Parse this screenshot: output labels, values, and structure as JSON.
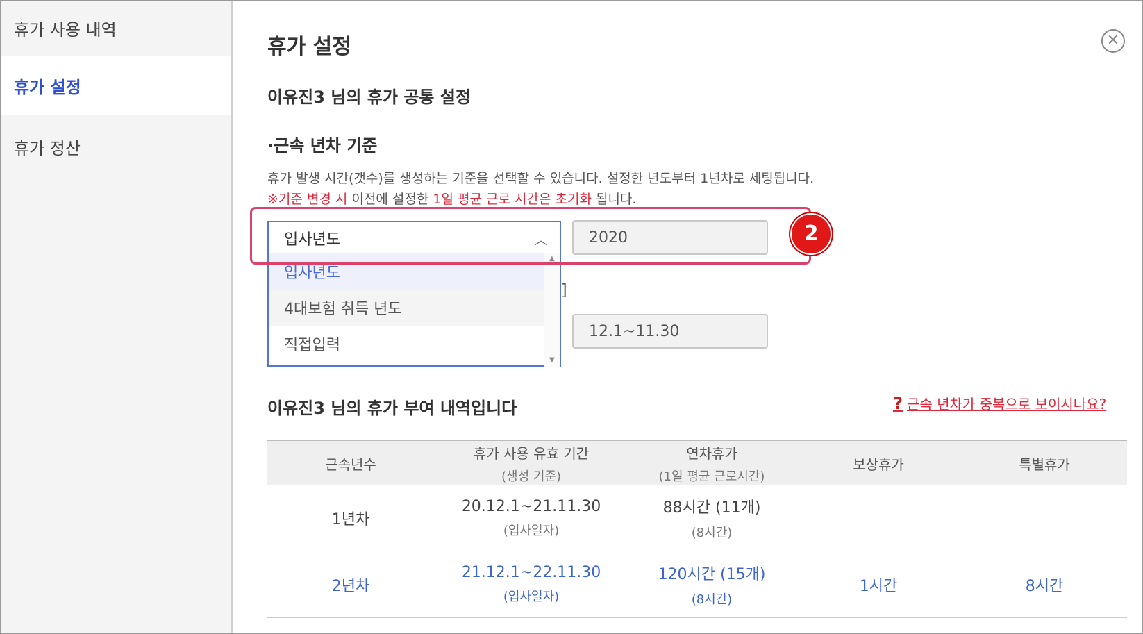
{
  "sidebar": {
    "items": [
      {
        "label": "휴가 사용 내역"
      },
      {
        "label": "휴가 설정"
      },
      {
        "label": "휴가 정산"
      }
    ]
  },
  "header": {
    "title": "휴가 설정",
    "close_icon": "close-circle-icon"
  },
  "settings": {
    "common_title": "이유진3 님의 휴가 공통 설정",
    "tenure_title": "·근속 년차 기준",
    "description": "휴가 발생 시간(갯수)를 생성하는 기준을 선택할 수 있습니다. 설정한 년도부터 1년차로 세팅됩니다.",
    "warning_parts": [
      "※기준 변경 시",
      " 이전에 설정한 ",
      "1일 평균 근로 시간은 초기화",
      " 됩니다."
    ],
    "select_value": "입사년도",
    "options": [
      "입사년도",
      "4대보험 취득 년도",
      "직접입력"
    ],
    "year_value": "2020",
    "partial_bracket": "]",
    "period_value": "12.1~11.30",
    "step_badge": "2"
  },
  "grant": {
    "title": "이유진3 님의 휴가 부여 내역입니다",
    "help_link": "근속 년차가 중복으로 보이시나요?",
    "columns": [
      {
        "main": "근속년수",
        "sub": ""
      },
      {
        "main": "휴가 사용 유효 기간",
        "sub": "(생성 기준)"
      },
      {
        "main": "연차휴가",
        "sub": "(1일 평균 근로시간)"
      },
      {
        "main": "보상휴가",
        "sub": ""
      },
      {
        "main": "특별휴가",
        "sub": ""
      }
    ],
    "rows": [
      {
        "year": "1년차",
        "period": "20.12.1~21.11.30",
        "period_sub": "(입사일자)",
        "annual": "88시간 (11개)",
        "annual_sub": "(8시간)",
        "comp": "",
        "special": ""
      },
      {
        "year": "2년차",
        "period": "21.12.1~22.11.30",
        "period_sub": "(입사일자)",
        "annual": "120시간 (15개)",
        "annual_sub": "(8시간)",
        "comp": "1시간",
        "special": "8시간"
      }
    ]
  },
  "colors": {
    "accent_blue": "#3d64d0",
    "warning_red": "#e0283c",
    "highlight_border": "#d9426a"
  }
}
